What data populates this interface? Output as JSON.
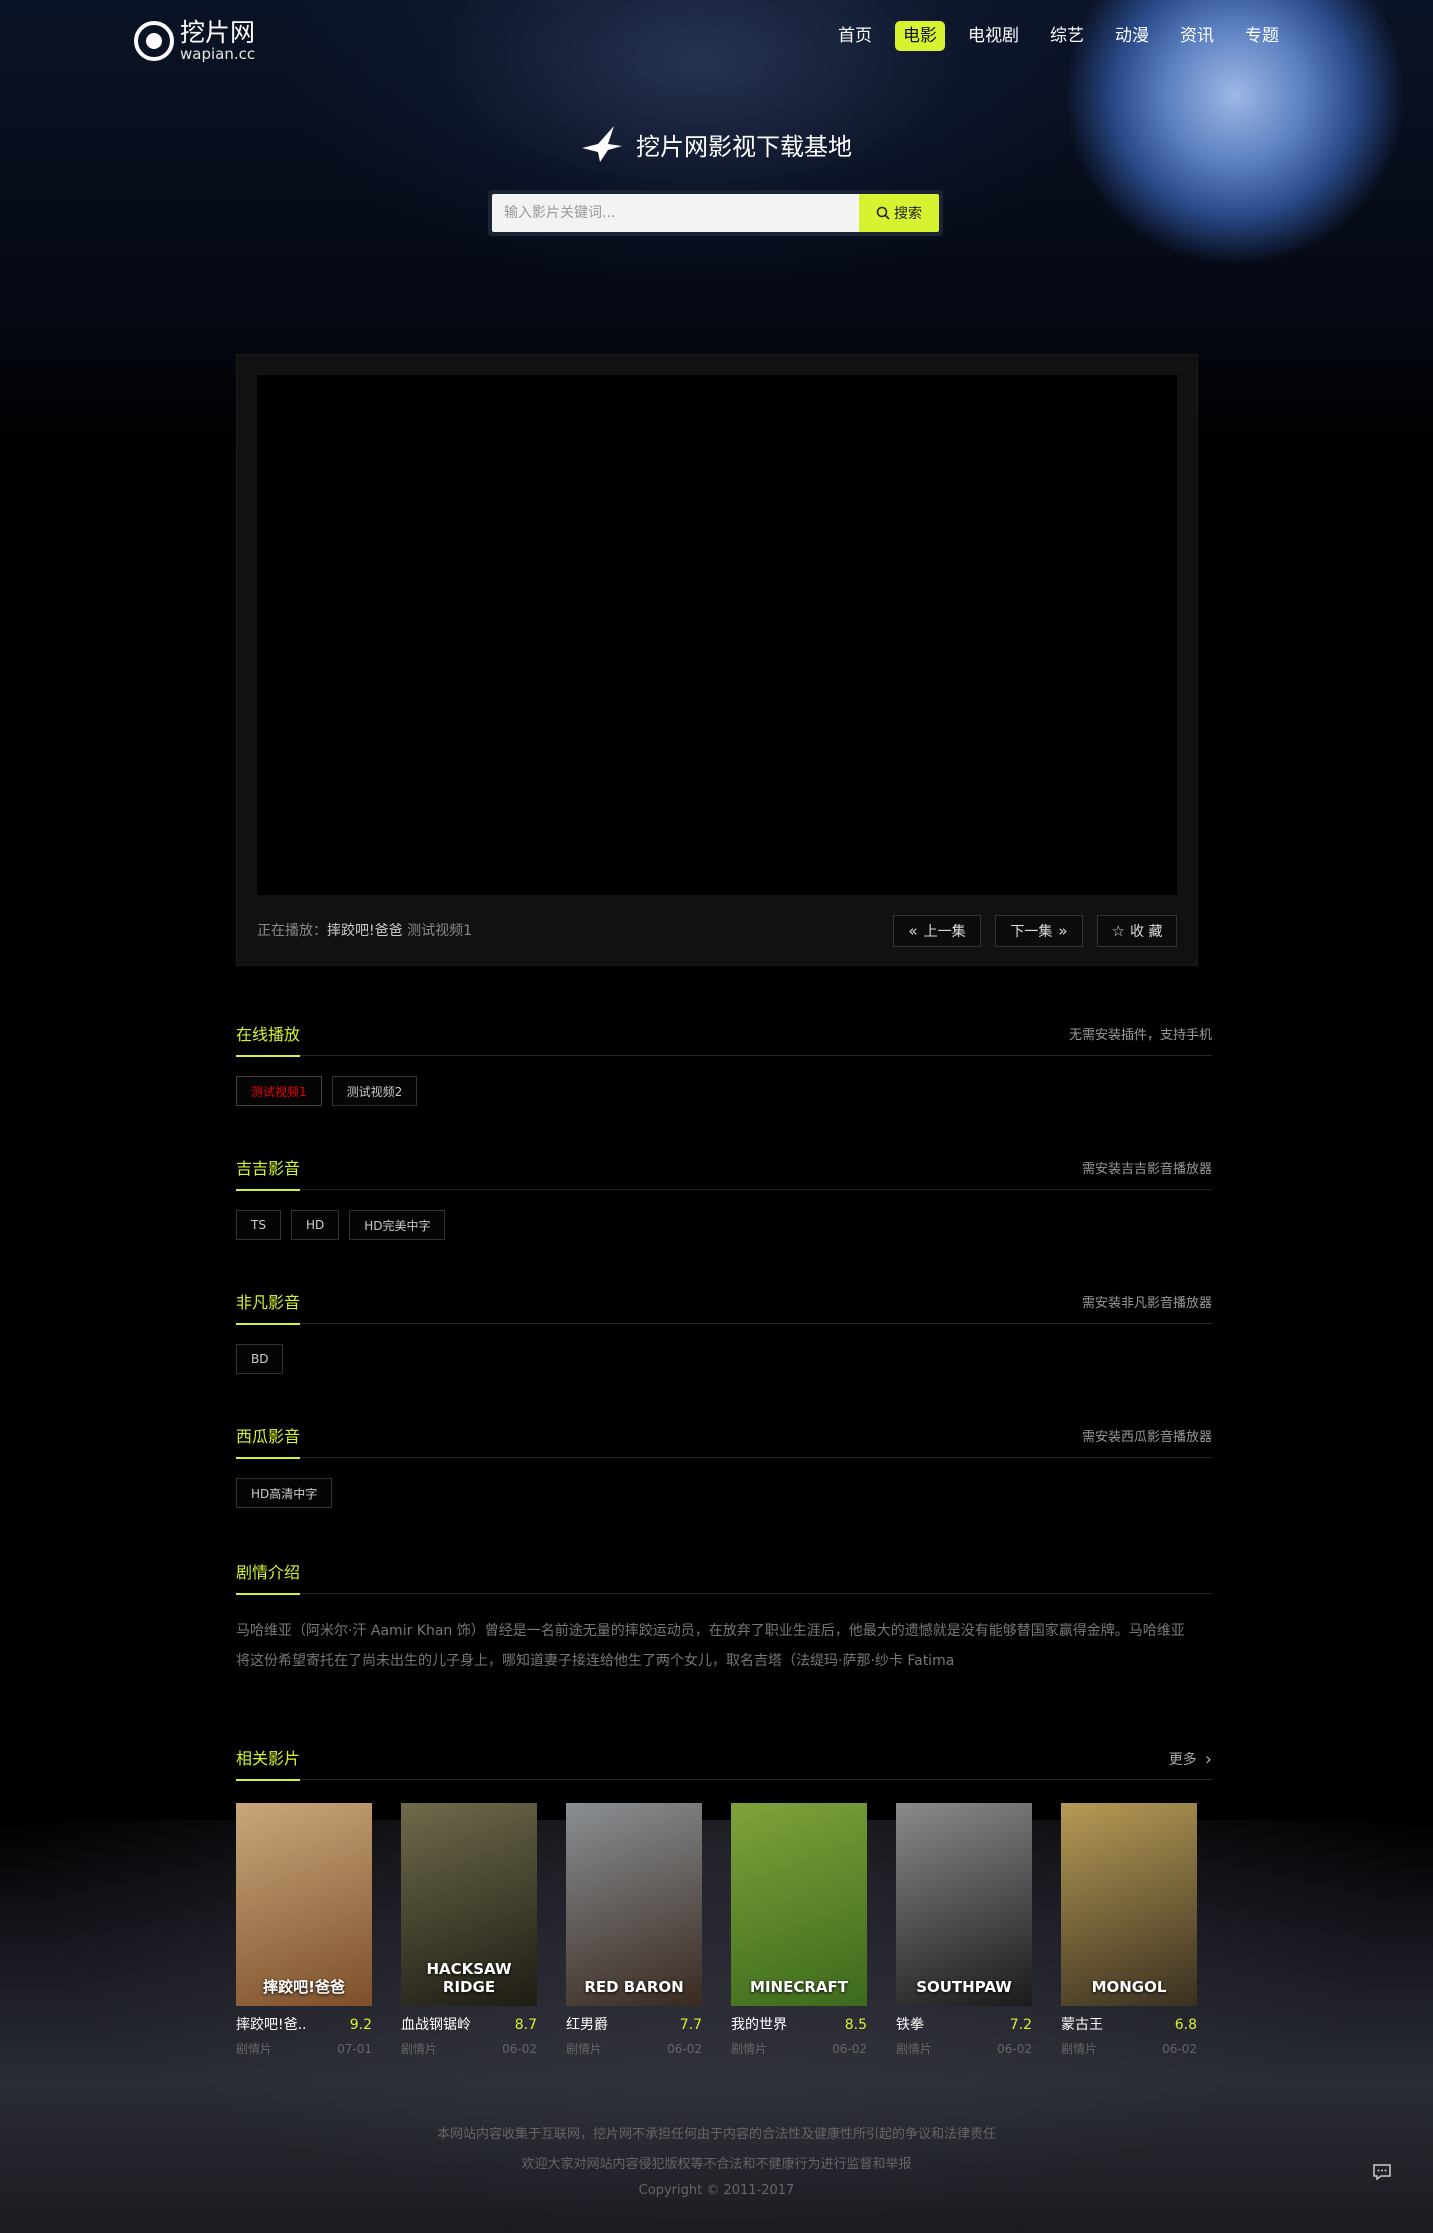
{
  "brand": {
    "name_cn": "挖片网",
    "name_en": "wapian.cc"
  },
  "nav": [
    {
      "label": "首页",
      "active": false
    },
    {
      "label": "电影",
      "active": true
    },
    {
      "label": "电视剧",
      "active": false
    },
    {
      "label": "综艺",
      "active": false
    },
    {
      "label": "动漫",
      "active": false
    },
    {
      "label": "资讯",
      "active": false
    },
    {
      "label": "专题",
      "active": false
    }
  ],
  "hero": {
    "title": "挖片网影视下载基地"
  },
  "search": {
    "placeholder": "输入影片关键词...",
    "button_label": "搜索"
  },
  "player": {
    "now_playing_label": "正在播放：",
    "now_playing_title": "摔跤吧!爸爸",
    "now_playing_episode": "测试视频1",
    "prev_label": "上一集",
    "next_label": "下一集",
    "fav_label": "收 藏"
  },
  "sections": [
    {
      "title": "在线播放",
      "note": "无需安装插件，支持手机",
      "tags": [
        "测试视频1",
        "测试视频2"
      ]
    },
    {
      "title": "吉吉影音",
      "note": "需安装吉吉影音播放器",
      "tags": [
        "TS",
        "HD",
        "HD完美中字"
      ]
    },
    {
      "title": "非凡影音",
      "note": "需安装非凡影音播放器",
      "tags": [
        "BD"
      ]
    },
    {
      "title": "西瓜影音",
      "note": "需安装西瓜影音播放器",
      "tags": [
        "HD高清中字"
      ]
    }
  ],
  "synopsis": {
    "title": "剧情介绍",
    "text": "马哈维亚（阿米尔·汗 Aamir Khan 饰）曾经是一名前途无量的摔跤运动员，在放弃了职业生涯后，他最大的遗憾就是没有能够替国家赢得金牌。马哈维亚将这份希望寄托在了尚未出生的儿子身上，哪知道妻子接连给他生了两个女儿，取名吉塔（法缇玛·萨那·纱卡 Fatima"
  },
  "related": {
    "title": "相关影片",
    "more_label": "更多",
    "movies": [
      {
        "name": "摔跤吧!爸..",
        "score": "9.2",
        "genre": "剧情片",
        "date": "07-01",
        "poster_label": "摔跤吧!爸爸",
        "colors": [
          "#c9a77a",
          "#7d4f2a"
        ]
      },
      {
        "name": "血战钢锯岭",
        "score": "8.7",
        "genre": "剧情片",
        "date": "06-02",
        "poster_label": "HACKSAW RIDGE",
        "colors": [
          "#6e6a4a",
          "#1e1c14"
        ]
      },
      {
        "name": "红男爵",
        "score": "7.7",
        "genre": "剧情片",
        "date": "06-02",
        "poster_label": "RED BARON",
        "colors": [
          "#8a8f93",
          "#3a2a20"
        ]
      },
      {
        "name": "我的世界",
        "score": "8.5",
        "genre": "剧情片",
        "date": "06-02",
        "poster_label": "MINECRAFT",
        "colors": [
          "#7fa23a",
          "#3c6a1c"
        ]
      },
      {
        "name": "铁拳",
        "score": "7.2",
        "genre": "剧情片",
        "date": "06-02",
        "poster_label": "SOUTHPAW",
        "colors": [
          "#8a8a8a",
          "#1a1a1a"
        ]
      },
      {
        "name": "蒙古王",
        "score": "6.8",
        "genre": "剧情片",
        "date": "06-02",
        "poster_label": "MONGOL",
        "colors": [
          "#b69a55",
          "#3a3020"
        ]
      }
    ]
  },
  "footer": {
    "line1": "本网站内容收集于互联网，挖片网不承担任何由于内容的合法性及健康性所引起的争议和法律责任",
    "line2": "欢迎大家对网站内容侵犯版权等不合法和不健康行为进行监督和举报",
    "copyright": "Copyright © 2011-2017"
  }
}
